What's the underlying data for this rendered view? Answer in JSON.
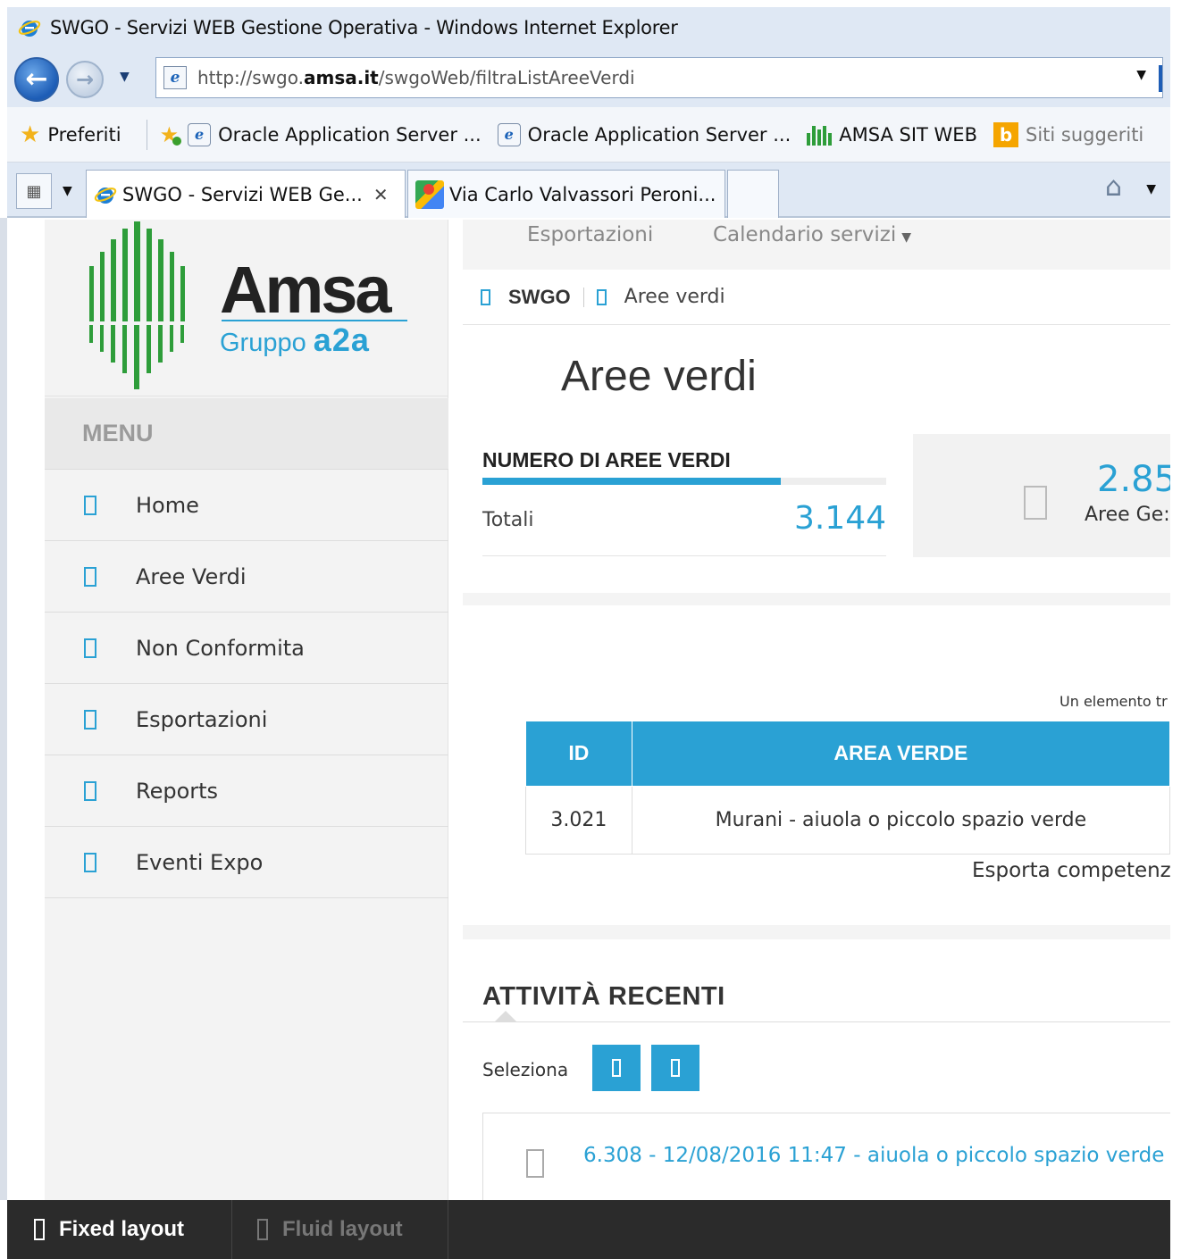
{
  "window": {
    "title": "SWGO - Servizi WEB Gestione Operativa - Windows Internet Explorer"
  },
  "address_bar": {
    "url_prefix": "http://swgo.",
    "url_domain": "amsa.it",
    "url_path": "/swgoWeb/filtraListAreeVerdi"
  },
  "favorites_bar": {
    "favorites_label": "Preferiti",
    "items": [
      {
        "label": "Oracle Application Server ...",
        "icon": "ie-page-icon"
      },
      {
        "label": "Oracle Application Server ...",
        "icon": "ie-page-icon"
      },
      {
        "label": "AMSA SIT WEB",
        "icon": "amsa-icon"
      },
      {
        "label": "Siti suggeriti",
        "icon": "bing-icon"
      }
    ]
  },
  "tabs": [
    {
      "label": "SWGO - Servizi WEB Ge...",
      "active": true
    },
    {
      "label": "Via Carlo Valvassori Peroni...",
      "active": false
    }
  ],
  "logo": {
    "word": "Amsa",
    "group_prefix": "Gruppo ",
    "group_brand": "a2a"
  },
  "sidebar": {
    "menu_header": "MENU",
    "items": [
      {
        "label": "Home"
      },
      {
        "label": "Aree Verdi"
      },
      {
        "label": "Non Conformita"
      },
      {
        "label": "Esportazioni"
      },
      {
        "label": "Reports"
      },
      {
        "label": "Eventi Expo"
      }
    ]
  },
  "topnav": {
    "items": [
      {
        "label": "Esportazioni"
      },
      {
        "label": "Calendario servizi"
      }
    ]
  },
  "breadcrumb": {
    "root": "SWGO",
    "current": "Aree verdi"
  },
  "page": {
    "title": "Aree verdi"
  },
  "stats": {
    "label": "NUMERO DI AREE VERDI",
    "row_label": "Totali",
    "row_value": "3.144",
    "bar_fill_fraction": 0.74
  },
  "kpi": {
    "value": "2.85",
    "label": "Aree Ge:"
  },
  "table": {
    "found_text": "Un elemento tr",
    "columns": [
      "ID",
      "AREA VERDE"
    ],
    "rows": [
      [
        "3.021",
        "Murani - aiuola o piccolo spazio verde"
      ]
    ],
    "export_label": "Esporta competenz"
  },
  "activity": {
    "title": "ATTIVITÀ RECENTI",
    "select_label": "Seleziona",
    "items": [
      {
        "text": "6.308 - 12/08/2016 11:47 - aiuola o piccolo spazio verde"
      }
    ]
  },
  "footer": {
    "fixed_label": "Fixed layout",
    "fluid_label": "Fluid layout"
  },
  "colors": {
    "accent": "#2aa1d4",
    "brand_green": "#2e9d3a",
    "footer_bg": "#2b2b2b"
  }
}
